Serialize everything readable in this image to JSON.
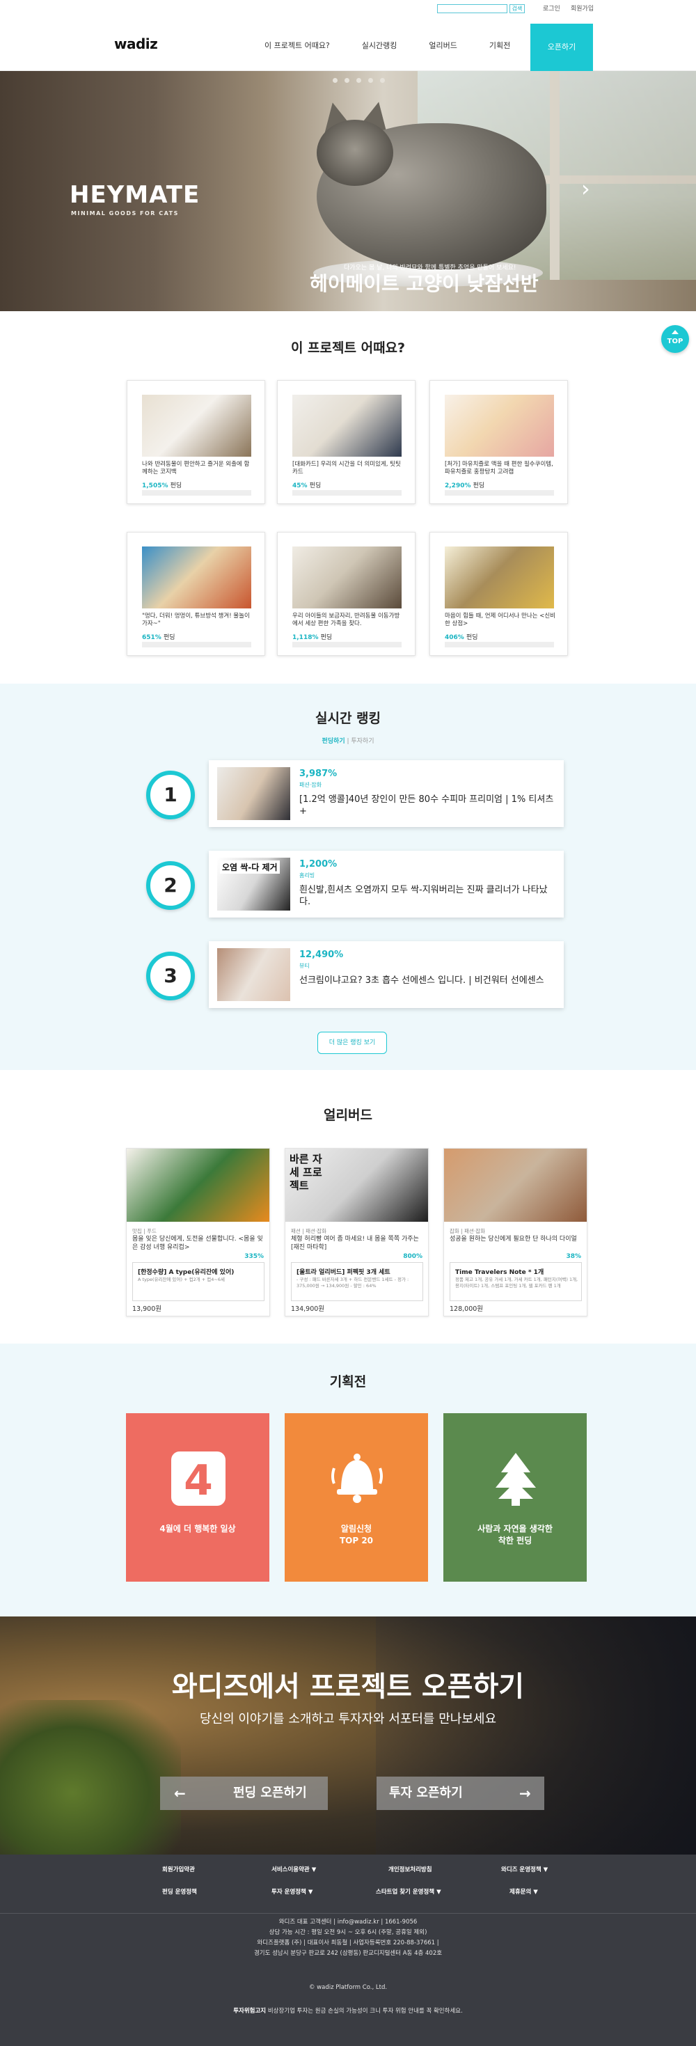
{
  "util": {
    "search_placeholder": "",
    "search_button": "검색",
    "login": "로그인",
    "join": "회원가입"
  },
  "header": {
    "logo": "wadiz",
    "nav": [
      "이 프로젝트 어때요?",
      "실시간랭킹",
      "얼리버드",
      "기획전"
    ],
    "open_button": "오픈하기"
  },
  "hero": {
    "brand": "HEYMATE",
    "brand_sub": "MINIMAL GOODS FOR CATS",
    "subtitle": "다가오는 봄 날, 나의 반려묘와 함께 특별한 추억을 만들어 보세요!",
    "title": "헤이메이트 고양이 낮잠선반",
    "slide_count": 5,
    "next_icon": "chevron-right-icon"
  },
  "project_section": {
    "title": "이 프로젝트 어때요?",
    "top_button": "TOP",
    "funding_word": "펀딩",
    "cards": [
      {
        "desc": "나와 반려동물이 편안하고 즐거운 외출에 함께하는 코지백",
        "percent": "1,505%",
        "image_colors": [
          "#e8e0d2",
          "#8a7458",
          "#f4f1ec"
        ]
      },
      {
        "desc": "[대화카드] 우리의 시간을 더 의미있게, 팃팃카드",
        "percent": "45%",
        "image_colors": [
          "#f1efeb",
          "#2f3a4e",
          "#e3ddd2"
        ]
      },
      {
        "desc": "[처가] 마유치즐로 맥을 때 편한 필수쿠이템, 파유치즐로 홍팡탕치 고려캡",
        "percent": "2,290%",
        "image_colors": [
          "#f8f1e8",
          "#e6a6a2",
          "#f2d7b0"
        ]
      },
      {
        "desc": "\"멍다, 더워! 멍멍이, 튜브방석 챙겨! 물놀이 가자~\"",
        "percent": "651%",
        "image_colors": [
          "#3a8fc7",
          "#c8552e",
          "#e8d1a8"
        ]
      },
      {
        "desc": "우리 아이들의 보금자리, 반려동물 이동가방에서 세상 편한 가족을 찾다.",
        "percent": "1,118%",
        "image_colors": [
          "#f0ece4",
          "#5a4a3a",
          "#cfc6b5"
        ]
      },
      {
        "desc": "마음이 힘들 때, 언제 어디서나 만나는 <신비한 상점>",
        "percent": "406%",
        "image_colors": [
          "#f5efd8",
          "#e0b94a",
          "#a88d5a"
        ]
      }
    ]
  },
  "ranking": {
    "title": "실시간 랭킹",
    "tab_funding": "펀딩하기",
    "tab_sep": " | ",
    "tab_invest": "투자하기",
    "more_button": "더 많은 랭킹 보기",
    "items": [
      {
        "rank": "1",
        "percent": "3,987%",
        "category": "패션·잡화",
        "name": "[1.2억 앵콜]40년 장인이 만든 80수 수피마 프리미엄 | 1% 티셔츠+",
        "thumb_text": "",
        "thumb_colors": [
          "#ecebe8",
          "#2f2f35",
          "#d8c5b0"
        ]
      },
      {
        "rank": "2",
        "percent": "1,200%",
        "category": "홈리빙",
        "name": "흰신발,흰셔츠 오염까지 모두 싹-지워버리는 진짜 클리너가 나타났다.",
        "thumb_text": "오염 싹-다 제거",
        "thumb_colors": [
          "#ffffff",
          "#222222",
          "#d8d8d8"
        ]
      },
      {
        "rank": "3",
        "percent": "12,490%",
        "category": "뷰티",
        "name": "선크림이냐고요? 3초 흡수 선에센스 입니다. | 비건워터 선에센스",
        "thumb_text": "",
        "thumb_colors": [
          "#b68f78",
          "#dcc2b0",
          "#eae2da"
        ]
      }
    ]
  },
  "early_bird": {
    "title": "얼리버드",
    "cards": [
      {
        "category": "맛집 | 푸드",
        "title": "몸을 잊은 당신에게, 도전을 선물합니다. <몸을 잊은 감성 녀행 유리컵>",
        "percent": "335%",
        "box_title": "[한정수량] A type(유리잔에 있어)",
        "box_desc": "A type(유리잔에 있어) + 컵2개 + 컵4~6세",
        "price": "13,900원",
        "image_colors": [
          "#f4f1ea",
          "#e88a1e",
          "#3c7a3a"
        ]
      },
      {
        "category": "패션 | 패션·잡화",
        "title": "체형 허리빵 여어 좀 마세요! 내 몸을 쪽쪽 가주는 [재진 마타학]",
        "percent": "800%",
        "box_title": "[울트라 얼리버드] 퍼펙핏 3개 세트",
        "box_desc": "- 구성 : 패드 바른자세 3개 + 하드 전문밴드 1세트 - 정가 : 375,000원 → 134,900원 - 할인 : 64%",
        "price": "134,900원",
        "image_colors": [
          "#efefef",
          "#1d1d1d",
          "#cfcfcf"
        ],
        "image_text": "바른 자세 프로젝트"
      },
      {
        "category": "잡화 | 패션·잡화",
        "title": "성공을 원하는 당신에게 필요한 단 하나의 다이얼",
        "percent": "38%",
        "box_title": "Time Travelers Note * 1개",
        "box_desc": "정품 제고 1개, 공유 가세 1개, 가세 카트 1개, 패턴지(여백) 1개, 용지(타이트) 1개, 스탬프 포인팅 1개, 웹 포카드 펜 1개",
        "price": "128,000원",
        "image_colors": [
          "#d59b6d",
          "#8f5a3a",
          "#c9b49c"
        ]
      }
    ]
  },
  "exhibition": {
    "title": "기획전",
    "cards": [
      {
        "label_line1": "4월에 더 행복한 일상",
        "label_line2": "",
        "color": "#ee6c61",
        "icon": "calendar-4-icon"
      },
      {
        "label_line1": "알림신청",
        "label_line2": "TOP 20",
        "color": "#f28a3c",
        "icon": "bell-icon"
      },
      {
        "label_line1": "사람과 자연을 생각한",
        "label_line2": "착한 펀딩",
        "color": "#5b8a4e",
        "icon": "tree-icon"
      }
    ]
  },
  "open_banner": {
    "title": "와디즈에서 프로젝트 오픈하기",
    "subtitle": "당신의 이야기를 소개하고 투자자와 서포터를 만나보세요",
    "funding_button": "펀딩 오픈하기",
    "invest_button": "투자 오픈하기"
  },
  "footer": {
    "links_row1": [
      "회원가입약관",
      "서비스이용약관 ▼",
      "개인정보처리방침",
      "와디즈 운영정책 ▼"
    ],
    "links_row2": [
      "펀딩 운영정책",
      "투자 운영정책 ▼",
      "스타트업 찾기 운영정책 ▼",
      "제휴문의 ▼"
    ],
    "info_lines": [
      "와디즈 대표 고객센터 | info@wadiz.kr | 1661-9056",
      "상담 가능 시간 : 평일 오전 9시 ~ 오후 6시 (주말, 공휴일 제외)",
      "와디즈플랫폼 (주) | 대표이사 최동철 | 사업자등록번호 220-88-37661 |",
      "경기도 성남시 분당구 판교로 242 (삼평동) 판교디지털센터 A동 4층 402호"
    ],
    "copyright": "© wadiz Platform Co., Ltd.",
    "warning_label": "투자위험고지",
    "warning_text": " 비상장기업 투자는 원금 손실의 가능성이 크니 투자 위험 안내를 꼭 확인하세요."
  }
}
